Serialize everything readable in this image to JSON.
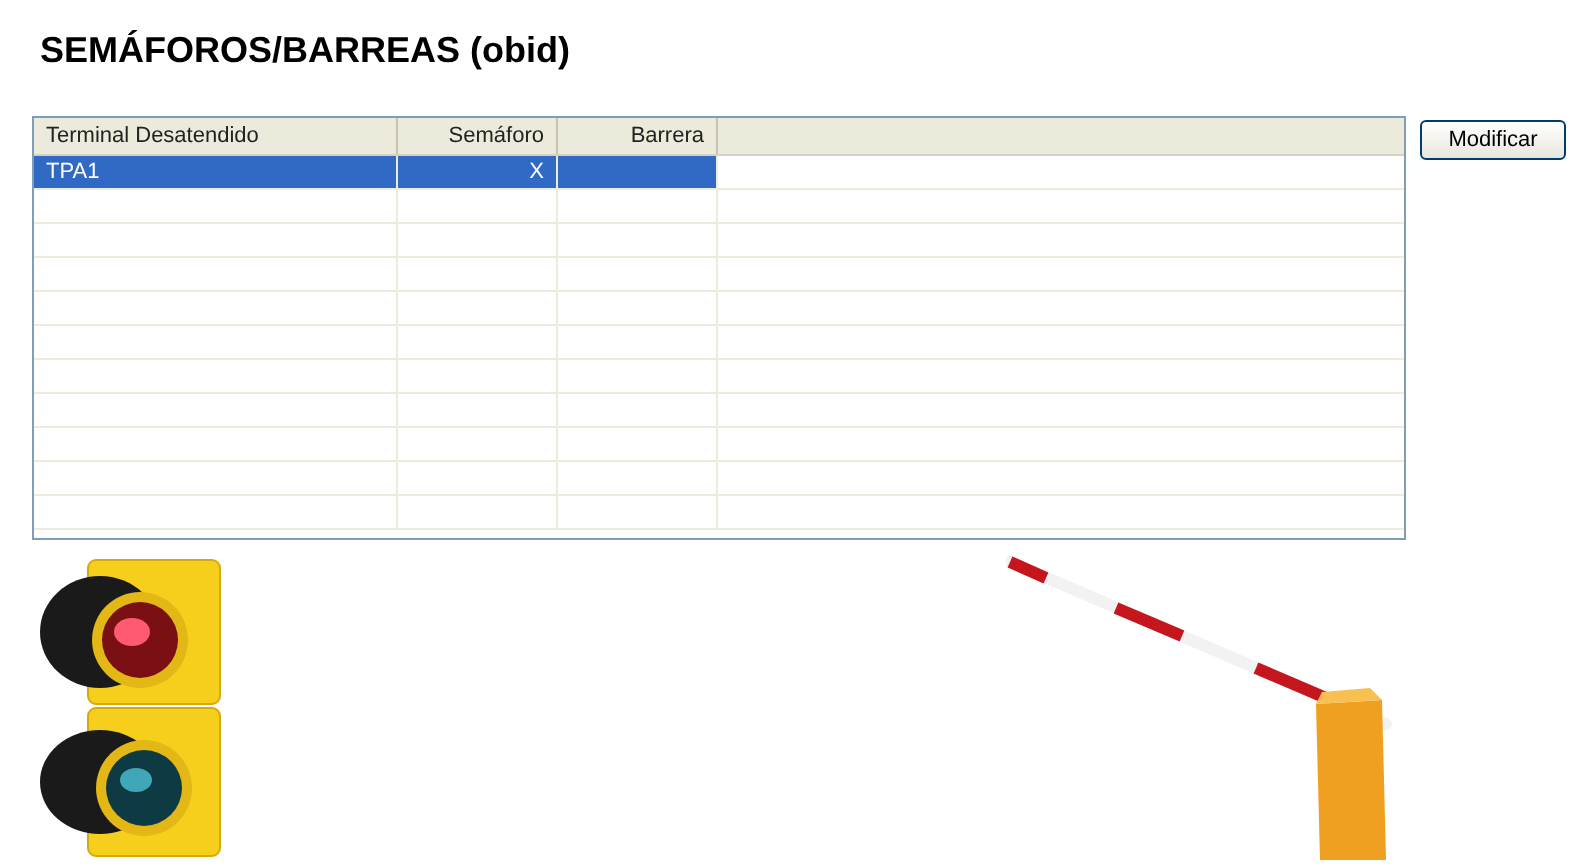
{
  "title": "SEMÁFOROS/BARREAS (obid)",
  "table": {
    "columns": [
      "Terminal Desatendido",
      "Semáforo",
      "Barrera"
    ],
    "rows": [
      {
        "terminal": "TPA1",
        "semaforo": "X",
        "selected": true
      }
    ]
  },
  "buttons": [
    "Modificar"
  ]
}
